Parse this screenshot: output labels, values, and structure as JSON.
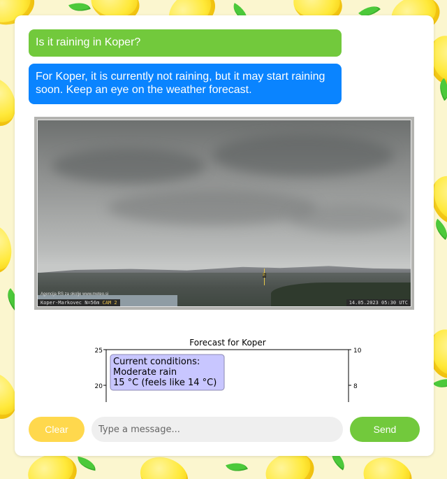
{
  "chat": {
    "messages": [
      {
        "role": "user",
        "text": "Is it raining in Koper?"
      },
      {
        "role": "assistant",
        "text": "For Koper, it is currently not raining, but it may start raining soon. Keep an eye on the weather forecast."
      }
    ]
  },
  "webcam": {
    "agency_text": "Agencija RS za okolje   www.meteo.si",
    "location_label": "Koper-Markovec  N=56m ",
    "cam_label": "CAM 2",
    "timestamp": "14.05.2023  05:30 UTC",
    "center_marker": "E"
  },
  "forecast_chart": {
    "title": "Forecast for Koper",
    "left_axis_ticks": [
      "25",
      "20"
    ],
    "right_axis_ticks": [
      "10",
      "8"
    ],
    "current_conditions": {
      "heading": "Current conditions:",
      "description": "Moderate rain",
      "temperature": "15 °C (feels like 14 °C)"
    }
  },
  "input_bar": {
    "clear_label": "Clear",
    "placeholder": "Type a message...",
    "send_label": "Send"
  },
  "colors": {
    "user_bubble": "#72c93c",
    "assistant_bubble": "#0a84ff",
    "clear_button": "#ffd84d",
    "send_button": "#72c93c",
    "legend_box": "#c8c6ff"
  }
}
